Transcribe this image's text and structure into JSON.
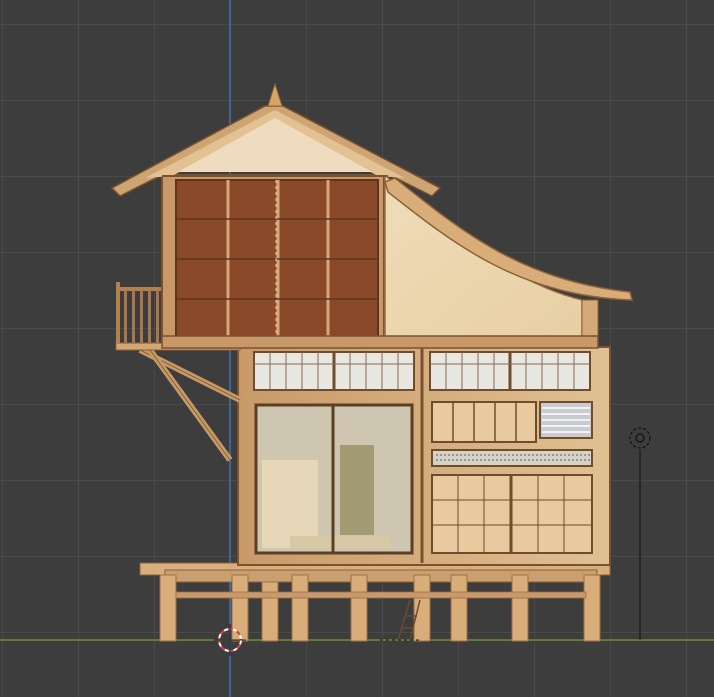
{
  "viewport": {
    "background_color": "#3d3d3d",
    "grid_color": "#4a4a4a",
    "z_axis_color": "#3f6fb0",
    "x_axis_color": "#6f8e3a"
  },
  "scene": {
    "object": "japanese-stilt-house",
    "view": "front-orthographic",
    "material_colors": {
      "light_wood": "#deb98a",
      "dark_wood": "#7a4a26",
      "panel_brown": "#8a4a2a",
      "shoji_paper": "#e8e6e0",
      "glass": "#cfc6b2"
    }
  },
  "overlays": {
    "origin_marker": "3d-cursor-icon",
    "light_gizmo": "light-object-icon",
    "camera_gizmo": "camera-object-icon"
  }
}
